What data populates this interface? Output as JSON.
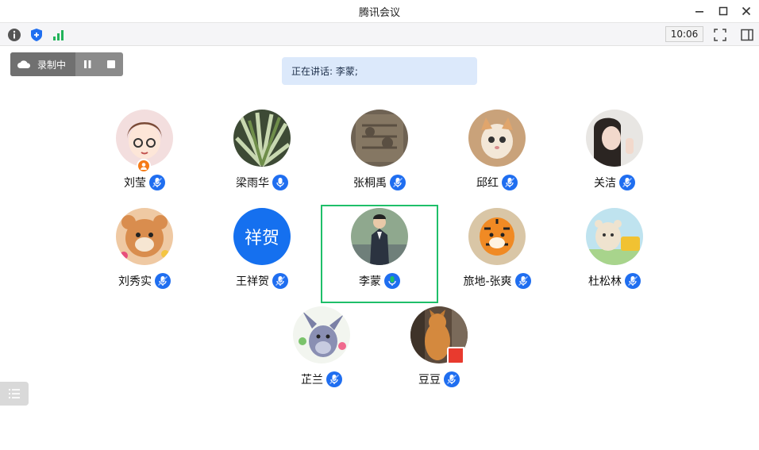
{
  "window": {
    "title": "腾讯会议"
  },
  "toolbar": {
    "info_icon": "info-icon",
    "security_icon": "shield-icon",
    "signal_icon": "signal-icon",
    "clock": "10:06",
    "fullscreen_icon": "fullscreen-icon",
    "sidebar_icon": "sidebar-toggle-icon"
  },
  "recording": {
    "label": "录制中",
    "pause_icon": "pause-icon",
    "stop_icon": "stop-icon"
  },
  "speaking": {
    "text": "正在讲话: 李蒙;"
  },
  "participants": [
    {
      "name": "刘莹",
      "mic": "muted",
      "host": true
    },
    {
      "name": "梁雨华",
      "mic": "on"
    },
    {
      "name": "张桐禹",
      "mic": "muted"
    },
    {
      "name": "邱红",
      "mic": "muted"
    },
    {
      "name": "关洁",
      "mic": "muted"
    },
    {
      "name": "刘秀实",
      "mic": "muted"
    },
    {
      "name": "王祥贺",
      "mic": "muted",
      "avatar_text": "祥贺"
    },
    {
      "name": "李蒙",
      "mic": "active",
      "speaking": true
    },
    {
      "name": "旅地-张爽",
      "mic": "muted"
    },
    {
      "name": "杜松林",
      "mic": "muted"
    },
    {
      "name": "芷兰",
      "mic": "muted"
    },
    {
      "name": "豆豆",
      "mic": "muted"
    }
  ],
  "colors": {
    "accent": "#1f6ef0",
    "active_mic": "#1fbf69",
    "host_badge": "#f57b18",
    "avatar_blue": "#1570ef"
  },
  "list_toggle": {
    "icon": "list-icon"
  }
}
